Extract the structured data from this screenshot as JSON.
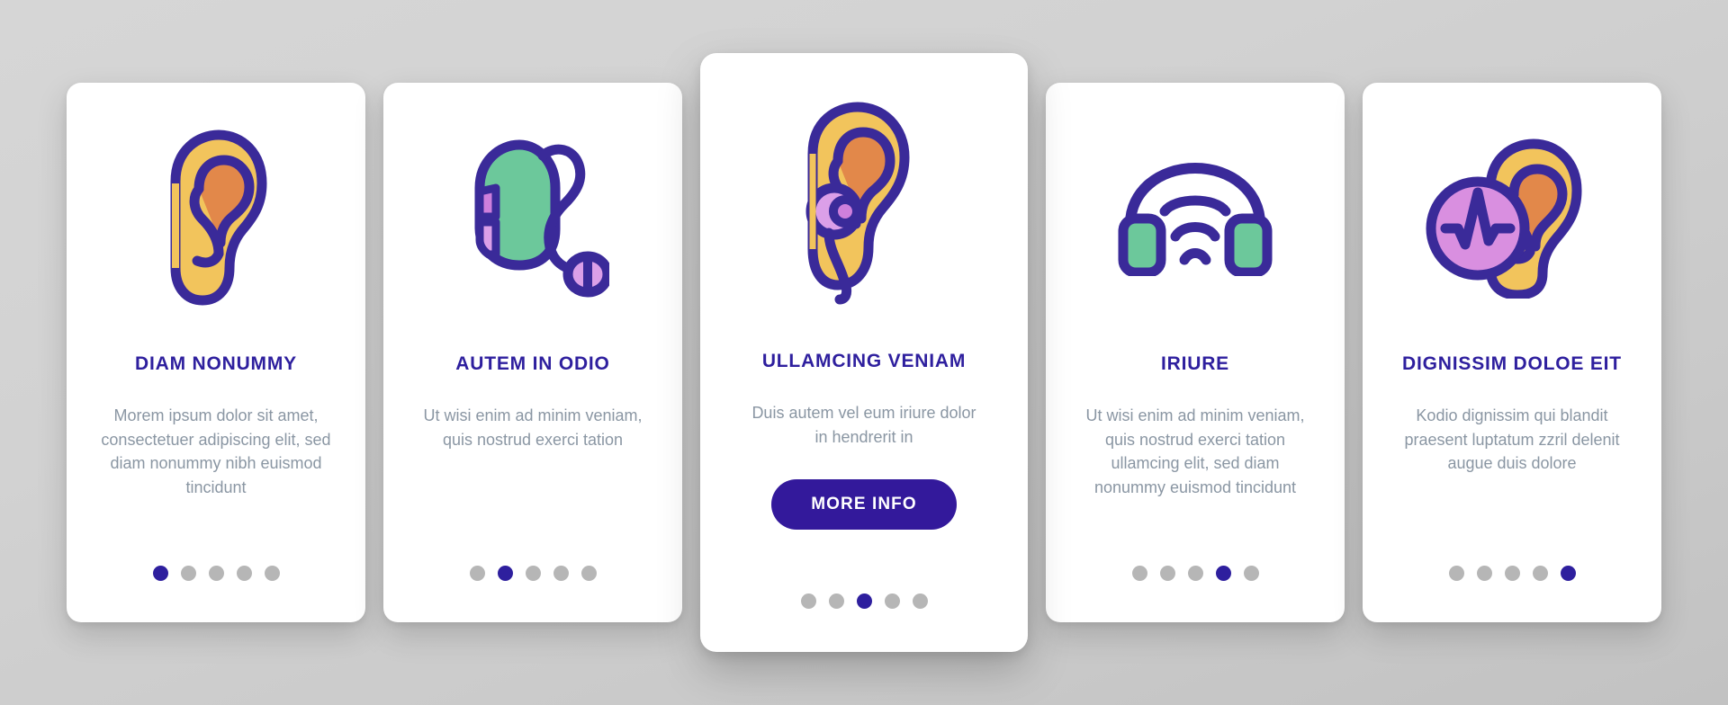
{
  "colors": {
    "background": "#d2d2d2",
    "card_background": "#ffffff",
    "brand_purple": "#2e1f9e",
    "button_purple": "#33199b",
    "body_text": "#8a96a3",
    "dot_inactive": "#b6b6b6",
    "ear_outer_yellow": "#f2c45c",
    "ear_inner_orange": "#e2884a",
    "hearing_aid_green": "#6cc89b",
    "accent_pink": "#d98fe0",
    "accent_light_pink": "#e3a8ea",
    "stroke_purple": "#3a2a99"
  },
  "cards": [
    {
      "icon": "ear-icon",
      "title": "DIAM NONUMMY",
      "body": "Morem ipsum dolor sit amet, consectetuer adipiscing elit, sed diam nonummy nibh euismod tincidunt",
      "button": null,
      "dots": {
        "count": 5,
        "active_index": 0
      },
      "featured": false
    },
    {
      "icon": "hearing-aid-icon",
      "title": "AUTEM IN ODIO",
      "body": "Ut wisi enim ad minim veniam, quis nostrud exerci tation",
      "button": null,
      "dots": {
        "count": 5,
        "active_index": 1
      },
      "featured": false
    },
    {
      "icon": "ear-with-hearing-aid-icon",
      "title": "ULLAMCING VENIAM",
      "body": "Duis autem vel eum iriure dolor in hendrerit in",
      "button": "MORE INFO",
      "dots": {
        "count": 5,
        "active_index": 2
      },
      "featured": true
    },
    {
      "icon": "headphones-icon",
      "title": "IRIURE",
      "body": "Ut wisi enim ad minim veniam, quis nostrud exerci tation ullamcing elit, sed diam nonummy euismod tincidunt",
      "button": null,
      "dots": {
        "count": 5,
        "active_index": 3
      },
      "featured": false
    },
    {
      "icon": "ear-audiogram-icon",
      "title": "DIGNISSIM DOLOE EIT",
      "body": "Kodio dignissim qui blandit praesent luptatum zzril delenit augue duis dolore",
      "button": null,
      "dots": {
        "count": 5,
        "active_index": 4
      },
      "featured": false
    }
  ]
}
